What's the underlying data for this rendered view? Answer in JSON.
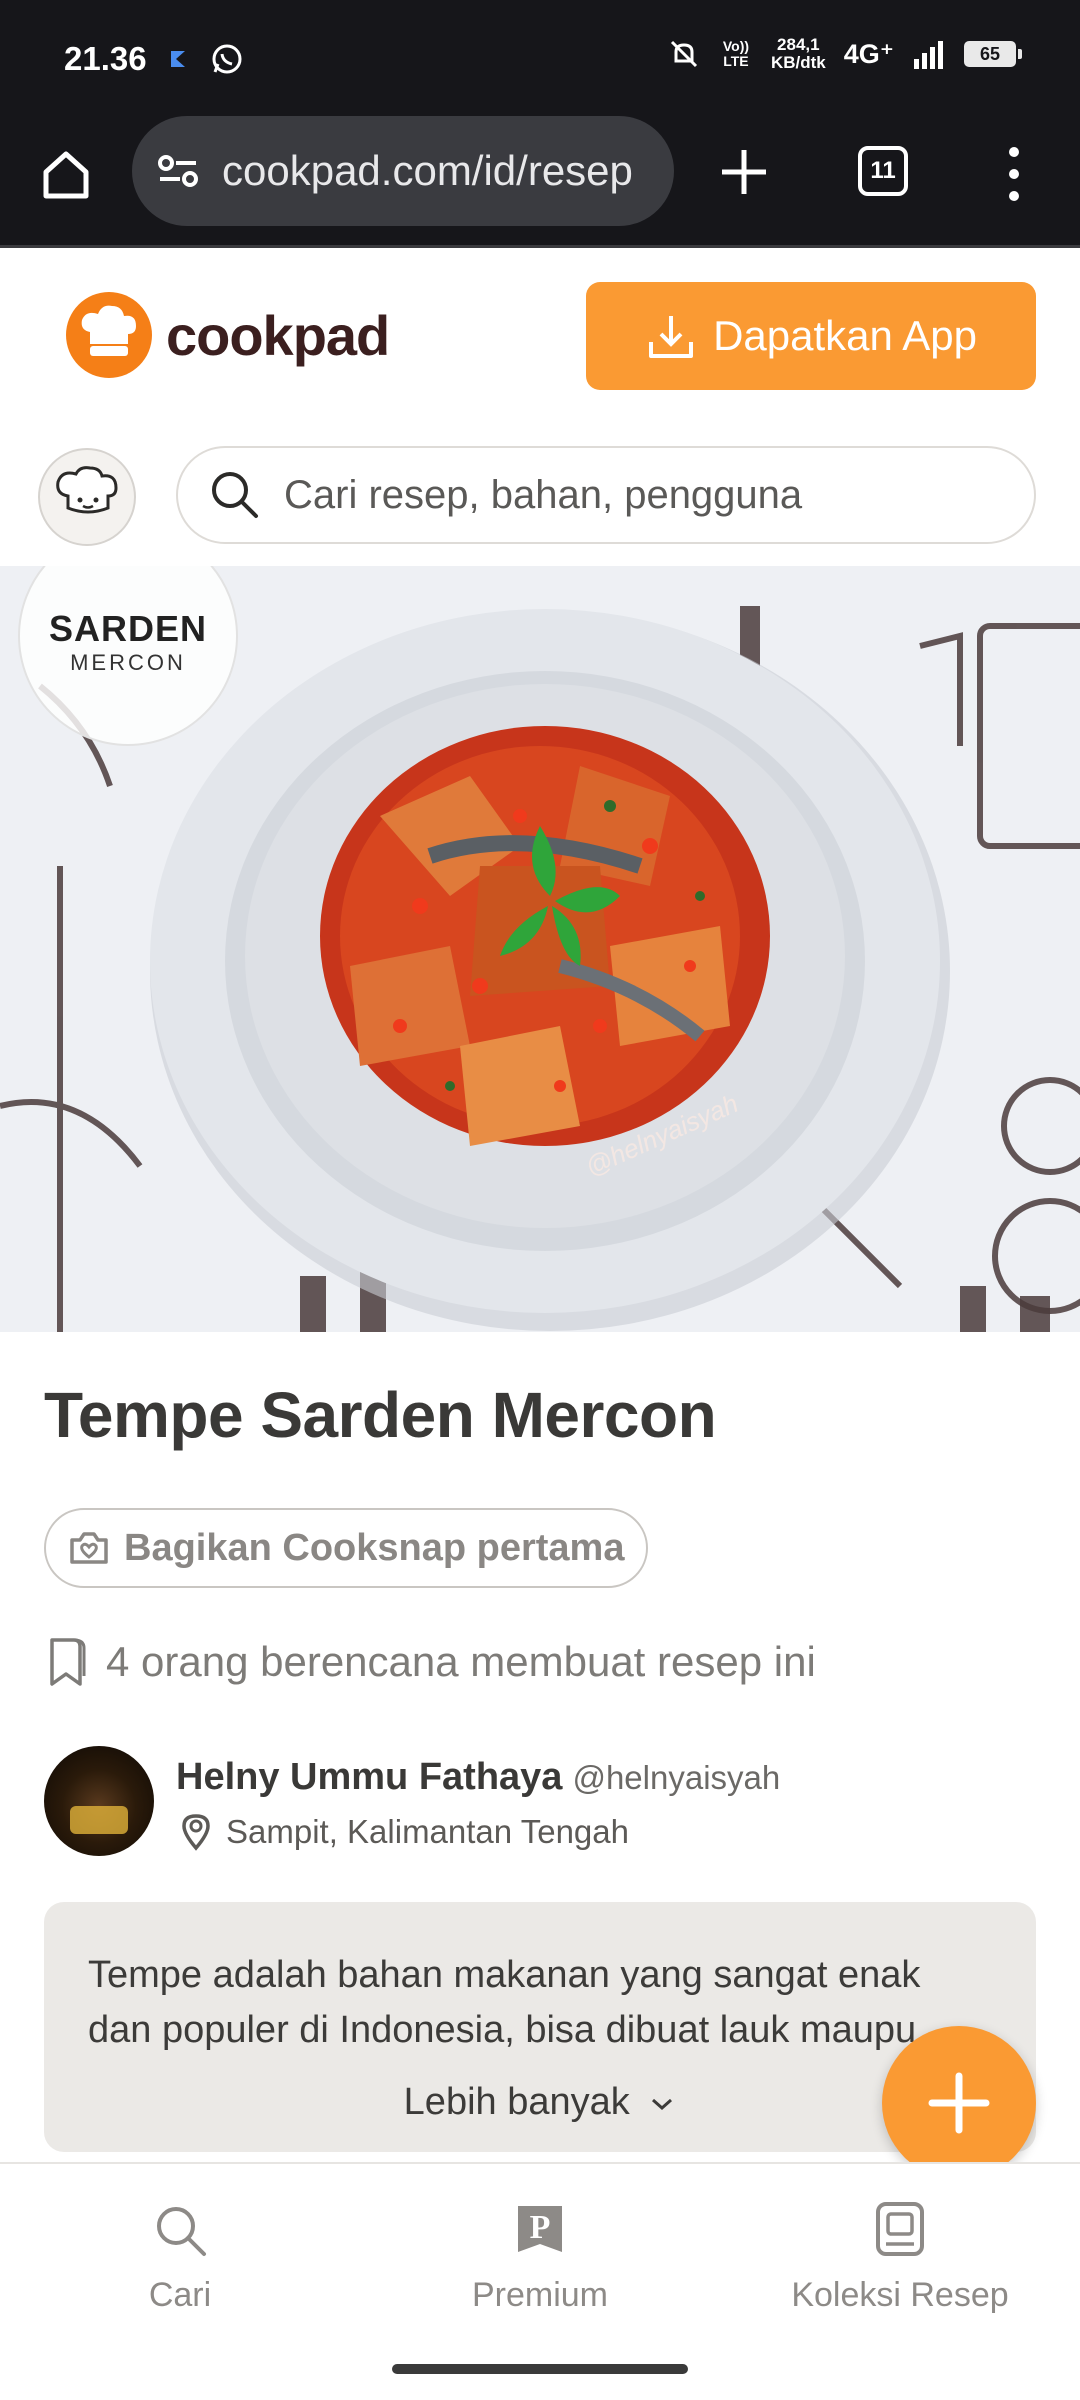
{
  "status_bar": {
    "time": "21.36",
    "network_speed_value": "284,1",
    "network_speed_unit": "KB/dtk",
    "network_type": "4G⁺",
    "volte": "Vo)) LTE",
    "battery": "65"
  },
  "browser": {
    "url": "cookpad.com/id/resep",
    "tab_count": "11"
  },
  "header": {
    "logo_text": "cookpad",
    "get_app_label": "Dapatkan App"
  },
  "search": {
    "placeholder": "Cari resep, bahan, pengguna"
  },
  "hero": {
    "badge_line1": "SARDEN",
    "badge_line2": "MERCON",
    "photo_watermark": "@helnyaisyah"
  },
  "recipe": {
    "title": "Tempe Sarden Mercon",
    "cooksnap_label": "Bagikan Cooksnap pertama",
    "planned_text": "4 orang berencana membuat resep ini",
    "author": {
      "name": "Helny Ummu Fathaya",
      "handle": "@helnyaisyah",
      "location": "Sampit, Kalimantan Tengah"
    },
    "description": "Tempe adalah bahan makanan yang sangat enak dan populer di Indonesia, bisa dibuat lauk maupu",
    "more_label": "Lebih banyak"
  },
  "bottom_nav": {
    "items": [
      {
        "label": "Cari",
        "icon": "search-icon"
      },
      {
        "label": "Premium",
        "icon": "premium-icon"
      },
      {
        "label": "Koleksi Resep",
        "icon": "collection-icon"
      }
    ]
  },
  "colors": {
    "brand_orange": "#fa9a33",
    "status_bar_bg": "#16161a"
  }
}
